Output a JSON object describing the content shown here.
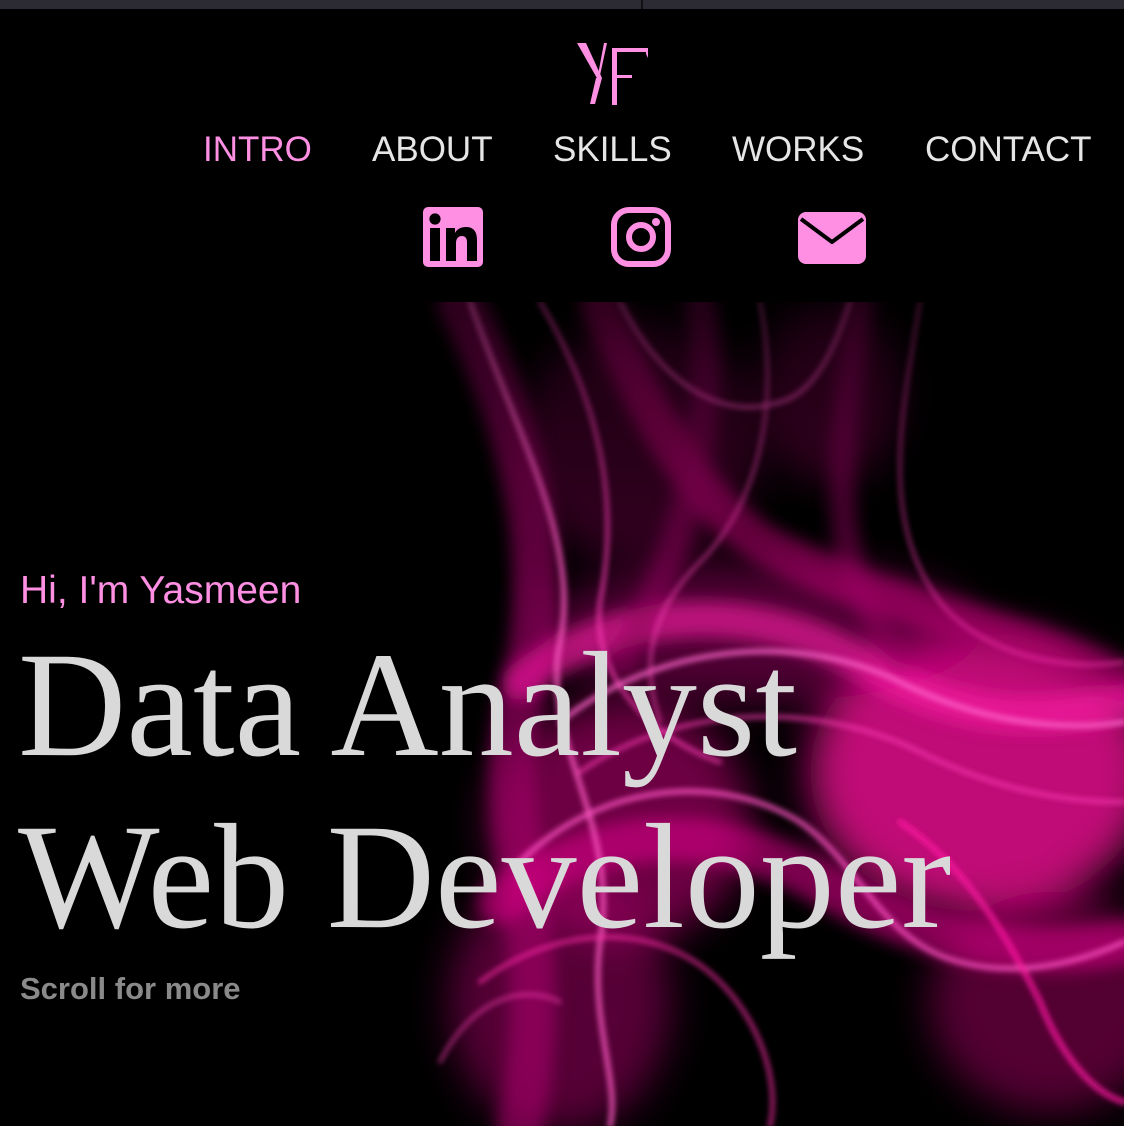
{
  "logo": {
    "text": "YF",
    "icon": "yf-monogram-logo"
  },
  "nav": {
    "items": [
      {
        "label": "INTRO",
        "active": true
      },
      {
        "label": "ABOUT",
        "active": false
      },
      {
        "label": "SKILLS",
        "active": false
      },
      {
        "label": "WORKS",
        "active": false
      },
      {
        "label": "CONTACT",
        "active": false
      }
    ]
  },
  "social": [
    {
      "icon": "linkedin-icon"
    },
    {
      "icon": "instagram-icon"
    },
    {
      "icon": "envelope-icon"
    }
  ],
  "hero": {
    "greeting": "Hi, I'm Yasmeen",
    "headline_line1": "Data Analyst",
    "headline_line2": "Web Developer",
    "scroll_hint": "Scroll for more"
  },
  "colors": {
    "background": "#000000",
    "accent_pink": "#ff8fe3",
    "nav_text": "#e6e6e6",
    "headline_text": "#d9d9d9",
    "scroll_hint_text": "#8a8a8a",
    "smoke_magenta": "#ff0a9e",
    "top_strip": "#2c2a33"
  }
}
